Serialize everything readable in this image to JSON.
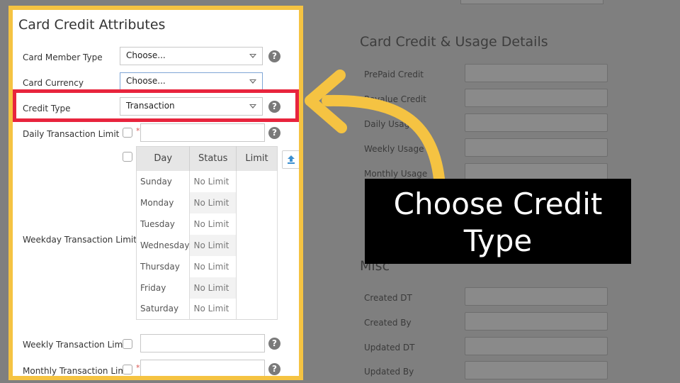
{
  "panel": {
    "title": "Card Credit Attributes",
    "card_member_type": {
      "label": "Card Member Type",
      "value": "Choose..."
    },
    "card_currency": {
      "label": "Card Currency",
      "value": "Choose..."
    },
    "credit_type": {
      "label": "Credit Type",
      "value": "Transaction"
    },
    "daily_limit": {
      "label": "Daily Transaction Limit"
    },
    "weekday_limit": {
      "label": "Weekday Transaction Limit",
      "headers": [
        "Day",
        "Status",
        "Limit"
      ],
      "rows": [
        {
          "day": "Sunday",
          "status": "No Limit"
        },
        {
          "day": "Monday",
          "status": "No Limit"
        },
        {
          "day": "Tuesday",
          "status": "No Limit"
        },
        {
          "day": "Wednesday",
          "status": "No Limit"
        },
        {
          "day": "Thursday",
          "status": "No Limit"
        },
        {
          "day": "Friday",
          "status": "No Limit"
        },
        {
          "day": "Saturday",
          "status": "No Limit"
        }
      ]
    },
    "weekly_limit": {
      "label": "Weekly Transaction Limit"
    },
    "monthly_limit": {
      "label": "Monthly Transaction Limit"
    },
    "help_glyph": "?",
    "required_glyph": "*"
  },
  "background": {
    "usage_title": "Card Credit & Usage Details",
    "usage_labels": [
      "PrePaid Credit",
      "Revalue Credit",
      "Daily Usage",
      "Weekly Usage",
      "Monthly Usage"
    ],
    "misc_title": "Misc",
    "misc_labels": [
      "Created DT",
      "Created By",
      "Updated DT",
      "Updated By"
    ]
  },
  "callout": {
    "line1": "Choose Credit",
    "line2": "Type"
  },
  "colors": {
    "panel_border": "#f5c342",
    "highlight": "#e8243d",
    "arrow": "#f5c342"
  }
}
